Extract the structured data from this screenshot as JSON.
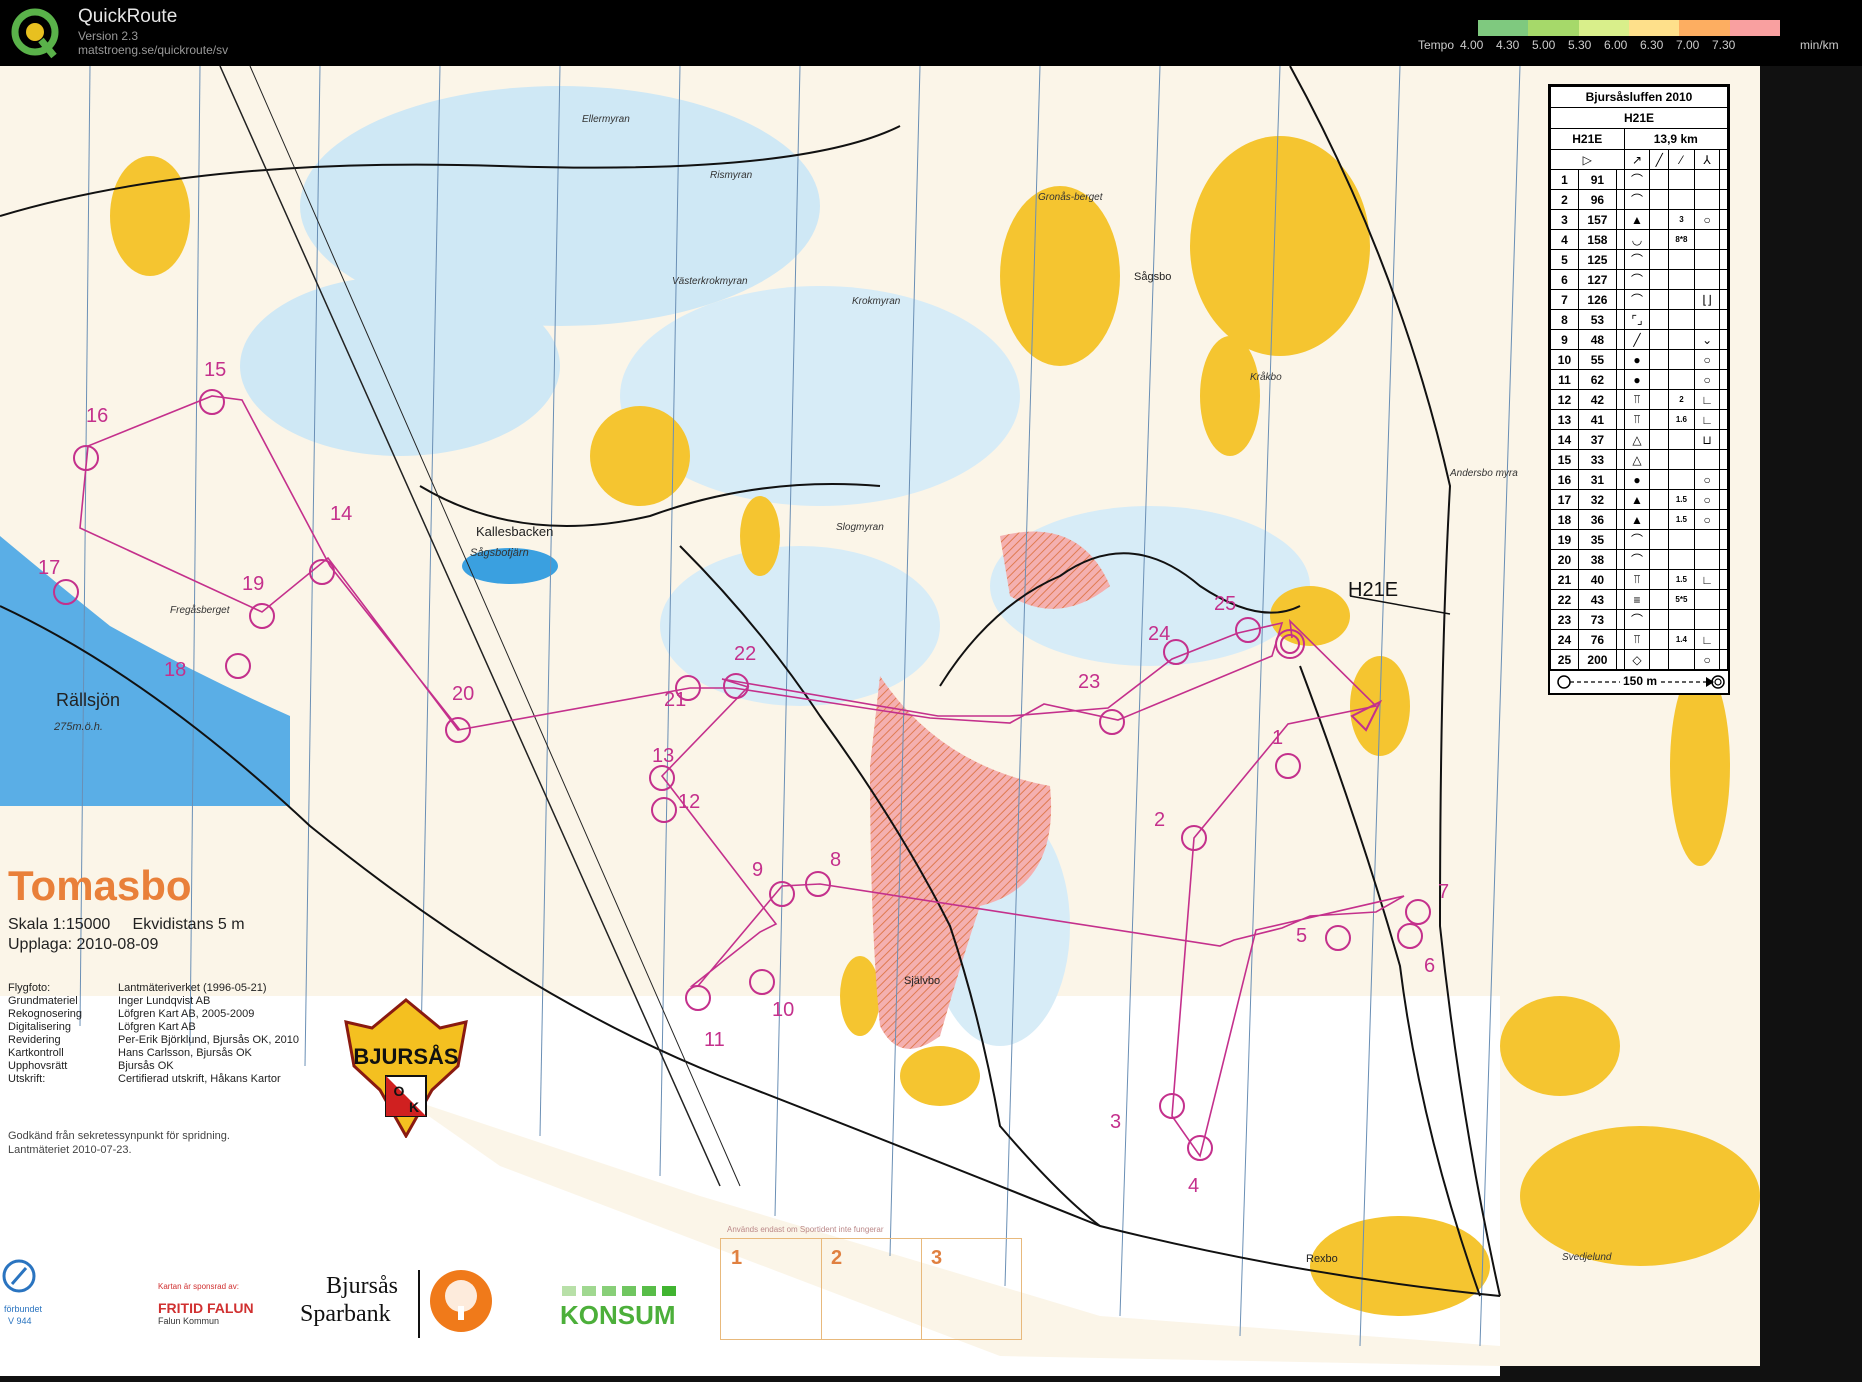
{
  "app": {
    "title": "QuickRoute",
    "version": "Version 2.3",
    "url": "matstroeng.se/quickroute/sv",
    "tempo_label": "Tempo",
    "tempo_ticks": [
      "4.00",
      "4.30",
      "5.00",
      "5.30",
      "6.00",
      "6.30",
      "7.00",
      "7.30"
    ],
    "tempo_unit": "min/km",
    "tempo_colors": [
      "#7fc97f",
      "#a6d96a",
      "#d9ef8b",
      "#fee08b",
      "#fdae61",
      "#f9a0a0"
    ]
  },
  "map": {
    "title": "Tomasbo",
    "scale": "Skala 1:15000",
    "contour": "Ekvidistans 5 m",
    "edition": "Upplaga: 2010-08-09",
    "credits": [
      {
        "k": "Flygfoto:",
        "v": "Lantmäteriverket (1996-05-21)"
      },
      {
        "k": "Grundmateriel",
        "v": "Inger Lundqvist AB"
      },
      {
        "k": "Rekognosering",
        "v": "Löfgren Kart AB, 2005-2009"
      },
      {
        "k": "Digitalisering",
        "v": "Löfgren Kart AB"
      },
      {
        "k": "Revidering",
        "v": "Per-Erik Björklund, Bjursås OK, 2010"
      },
      {
        "k": "Kartkontroll",
        "v": "Hans Carlsson, Bjursås OK"
      },
      {
        "k": "Upphovsrätt",
        "v": "Bjursås OK"
      },
      {
        "k": "Utskrift:",
        "v": "Certifierad utskrift, Håkans Kartor"
      }
    ],
    "approval": "Godkänd från sekretessynpunkt för spridning.",
    "approval2": "Lantmäteriet 2010-07-23.",
    "club": "BJURSÅS",
    "club_o": "O",
    "club_k": "K",
    "class_label": "H21E",
    "places": {
      "rallsjon": "Rällsjön",
      "rallsjon_h": "275m.ö.h.",
      "kallesbacken": "Kallesbacken",
      "sagsbotjarn": "Sågsbotjärn",
      "fregasberget": "Fregåsberget",
      "ellermyran": "Ellermyran",
      "rismyran": "Rismyran",
      "vasterkrokmyran": "Västerkrokmyran",
      "krokmyran": "Krokmyran",
      "slogmyran": "Slogmyran",
      "gronasberget": "Gronås-berget",
      "sagsbo": "Sågsbo",
      "krakbo": "Kråkbo",
      "andersbo": "Andersbo myra",
      "sjalvbo": "Självbo",
      "rexbo": "Rexbo",
      "svedjelund": "Svedjelund"
    },
    "controls": [
      "1",
      "2",
      "3",
      "4",
      "5",
      "6",
      "7",
      "8",
      "9",
      "10",
      "11",
      "12",
      "13",
      "14",
      "15",
      "16",
      "17",
      "18",
      "19",
      "20",
      "21",
      "22",
      "23",
      "24",
      "25"
    ]
  },
  "description": {
    "event": "Bjursåsluffen 2010",
    "class": "H21E",
    "class2": "H21E",
    "length": "13,9 km",
    "rows": [
      {
        "n": "1",
        "c": "91",
        "s": "⌒"
      },
      {
        "n": "2",
        "c": "96",
        "s": "⌒"
      },
      {
        "n": "3",
        "c": "157",
        "s": "▲",
        "d": "3",
        "e": "○"
      },
      {
        "n": "4",
        "c": "158",
        "s": "◡",
        "d": "8*8"
      },
      {
        "n": "5",
        "c": "125",
        "s": "⌒"
      },
      {
        "n": "6",
        "c": "127",
        "s": "⌒"
      },
      {
        "n": "7",
        "c": "126",
        "s": "⌒",
        "e": "⌊⌋"
      },
      {
        "n": "8",
        "c": "53",
        "s": "⌜⌟"
      },
      {
        "n": "9",
        "c": "48",
        "s": "╱",
        "e": "⌄"
      },
      {
        "n": "10",
        "c": "55",
        "s": "●",
        "e": "○"
      },
      {
        "n": "11",
        "c": "62",
        "s": "●",
        "e": "○"
      },
      {
        "n": "12",
        "c": "42",
        "s": "⫪",
        "d": "2",
        "e": "∟"
      },
      {
        "n": "13",
        "c": "41",
        "s": "⫪",
        "d": "1.6",
        "e": "∟"
      },
      {
        "n": "14",
        "c": "37",
        "s": "△",
        "e": "⊔"
      },
      {
        "n": "15",
        "c": "33",
        "s": "△"
      },
      {
        "n": "16",
        "c": "31",
        "s": "●",
        "e": "○"
      },
      {
        "n": "17",
        "c": "32",
        "s": "▲",
        "d": "1.5",
        "e": "○"
      },
      {
        "n": "18",
        "c": "36",
        "s": "▲",
        "d": "1.5",
        "e": "○"
      },
      {
        "n": "19",
        "c": "35",
        "s": "⌒"
      },
      {
        "n": "20",
        "c": "38",
        "s": "⌒"
      },
      {
        "n": "21",
        "c": "40",
        "s": "⫪",
        "d": "1.5",
        "e": "∟"
      },
      {
        "n": "22",
        "c": "43",
        "s": "≡",
        "d": "5*5"
      },
      {
        "n": "23",
        "c": "73",
        "s": "⌒"
      },
      {
        "n": "24",
        "c": "76",
        "s": "⫪",
        "d": "1.4",
        "e": "∟"
      },
      {
        "n": "25",
        "c": "200",
        "s": "◇",
        "e": "○"
      }
    ],
    "finish": "150 m"
  },
  "sponsors": {
    "si_caption": "Används endast om Sportident inte fungerar",
    "si_boxes": [
      "1",
      "2",
      "3"
    ],
    "fritid": "FRITID FALUN",
    "fritid_sub": "Falun Kommun",
    "fritid_cap": "Kartan är sponsrad av:",
    "sparbank1": "Bjursås",
    "sparbank2": "Sparbank",
    "konsum": "KONSUM",
    "forbund": "förbundet",
    "forbund_num": "V 944"
  }
}
